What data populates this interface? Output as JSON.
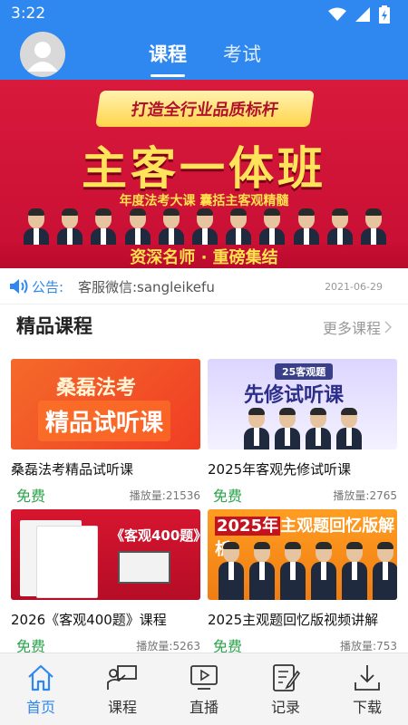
{
  "status_bar": {
    "time": "3:22"
  },
  "header": {
    "tabs": [
      {
        "label": "课程",
        "active": true
      },
      {
        "label": "考试",
        "active": false
      }
    ]
  },
  "banner": {
    "ribbon": "打造全行业品质标杆",
    "headline": "主客一体班",
    "subline": "年度法考大课  囊括主客观精髓",
    "slogan": "资深名师 · 重磅集结"
  },
  "notice": {
    "label": "公告:",
    "text": "客服微信:sangleikefu",
    "date": "2021-06-29"
  },
  "section": {
    "title": "精品课程",
    "more": "更多课程"
  },
  "courses": [
    {
      "thumb_lines": [
        "桑磊法考",
        "精品试听课"
      ],
      "title": "桑磊法考精品试听课",
      "price": "免费",
      "plays": "播放量:21536"
    },
    {
      "thumb_lines": [
        "25客观题",
        "先修试听课"
      ],
      "title": "2025年客观先修试听课",
      "price": "免费",
      "plays": "播放量:2765"
    },
    {
      "thumb_lines": [
        "《客观400题》"
      ],
      "title": "2026《客观400题》课程",
      "price": "免费",
      "plays": "播放量:5263"
    },
    {
      "thumb_lines": [
        "2025年",
        "主观题回忆版解析"
      ],
      "title": "2025主观题回忆版视频讲解",
      "price": "免费",
      "plays": "播放量:753"
    }
  ],
  "tabbar": [
    {
      "label": "首页",
      "icon": "home-icon",
      "active": true
    },
    {
      "label": "课程",
      "icon": "teacher-board-icon",
      "active": false
    },
    {
      "label": "直播",
      "icon": "live-play-icon",
      "active": false
    },
    {
      "label": "记录",
      "icon": "notepad-pen-icon",
      "active": false
    },
    {
      "label": "下载",
      "icon": "download-icon",
      "active": false
    }
  ],
  "colors": {
    "primary": "#2f87f0",
    "banner_red": "#d81a3c",
    "free_green": "#2aa44a",
    "muted_text": "#999999"
  }
}
